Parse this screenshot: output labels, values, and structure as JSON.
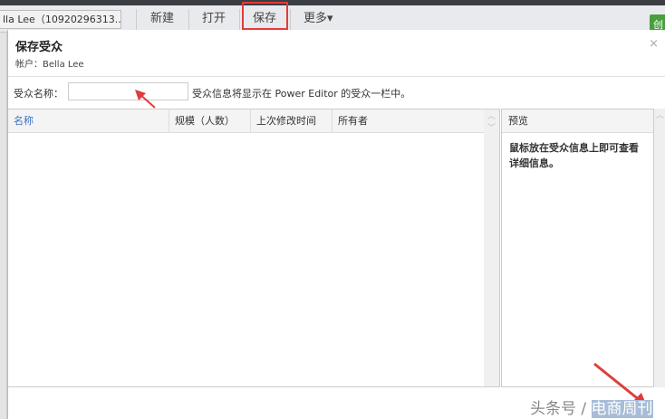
{
  "toolbar": {
    "account": "lla Lee（10920296313...",
    "new": "新建",
    "open": "打开",
    "save": "保存",
    "more": "更多",
    "create": "创"
  },
  "dialog": {
    "title": "保存受众",
    "account_line": "帐户：Bella Lee",
    "close": "×",
    "name_label": "受众名称：",
    "name_value": "",
    "hint": "受众信息将显示在 Power Editor 的受众一栏中。",
    "columns": [
      "名称",
      "规模（人数）",
      "上次修改时间",
      "所有者"
    ],
    "preview_title": "预览",
    "preview_text": "鼠标放在受众信息上即可查看详细信息。"
  },
  "watermark": {
    "prefix": "头条号 / ",
    "brand": "电商周刊"
  },
  "colors": {
    "accent": "#3b73c8",
    "highlight": "#e23b3b"
  }
}
